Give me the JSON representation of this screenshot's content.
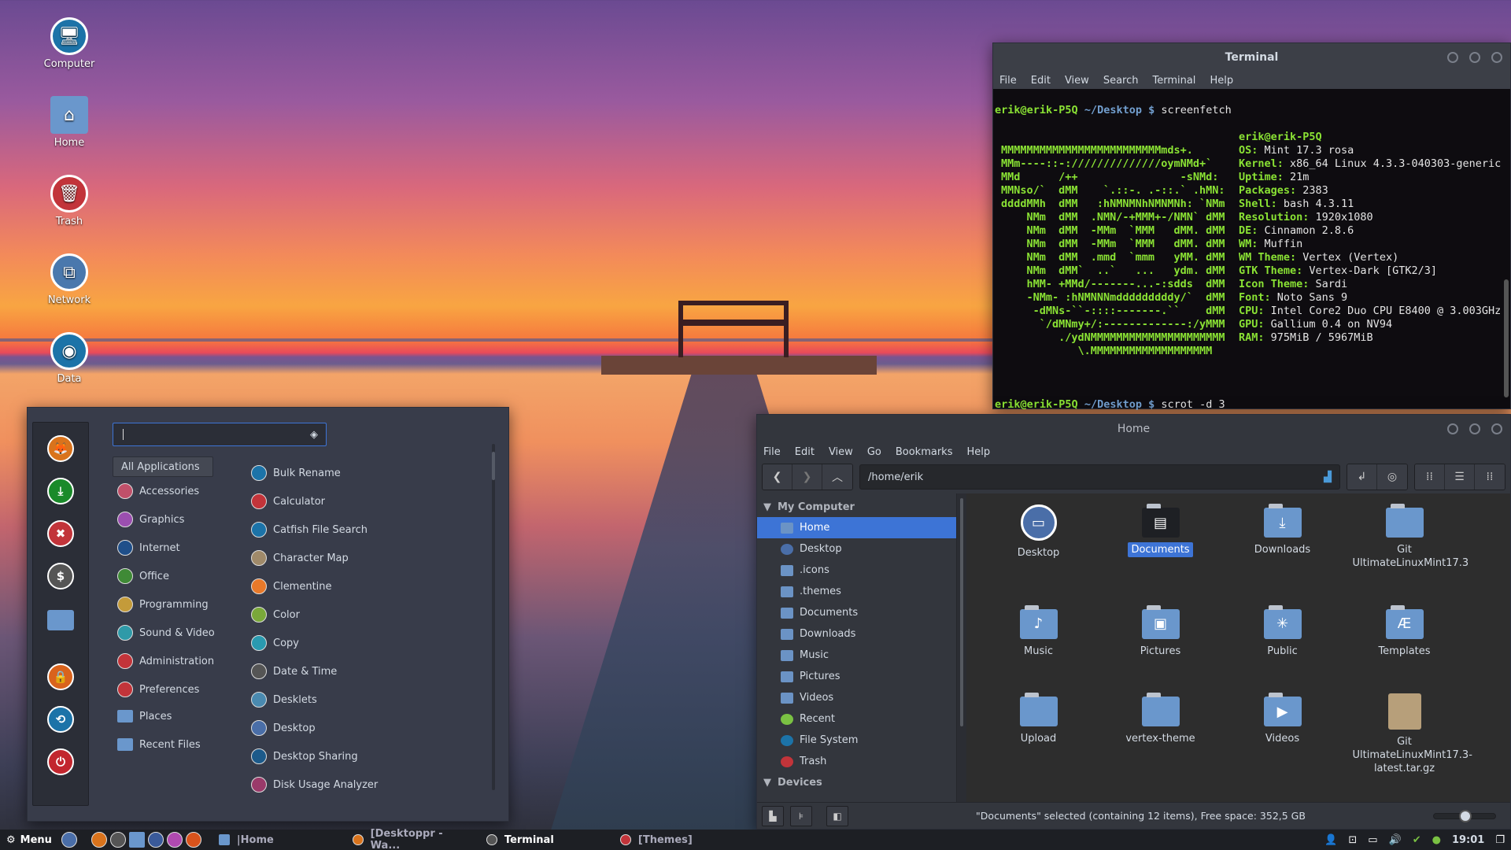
{
  "desktop": {
    "icons": [
      {
        "label": "Computer",
        "icon": "computer-icon",
        "color": "#1c73a8"
      },
      {
        "label": "Home",
        "icon": "home-folder-icon",
        "color": "#6a97cc"
      },
      {
        "label": "Trash",
        "icon": "trash-icon",
        "color": "#c2343a"
      },
      {
        "label": "Network",
        "icon": "network-icon",
        "color": "#4a78ad"
      },
      {
        "label": "Data",
        "icon": "drive-icon",
        "color": "#1c73a8"
      }
    ]
  },
  "terminal": {
    "title": "Terminal",
    "menu": [
      "File",
      "Edit",
      "View",
      "Search",
      "Terminal",
      "Help"
    ],
    "prompt_user": "erik@erik-P5Q",
    "prompt_path": "~/Desktop $",
    "command1": "screenfetch",
    "command2": "scrot -d 3",
    "ascii": [
      "MMMMMMMMMMMMMMMMMMMMMMMMMmds+.",
      "MMm----::-://////////////oymNMd+`",
      "MMd      /++                -sNMd:",
      "MMNso/`  dMM    `.::-. .-::.` .hMN:",
      "ddddMMh  dMM   :hNMNMNhNMNMNh: `NMm",
      "    NMm  dMM  .NMN/-+MMM+-/NMN` dMM",
      "    NMm  dMM  -MMm  `MMM   dMM. dMM",
      "    NMm  dMM  -MMm  `MMM   dMM. dMM",
      "    NMm  dMM  .mmd  `mmm   yMM. dMM",
      "    NMm  dMM`  ..`   ...   ydm. dMM",
      "    hMM- +MMd/-------...-:sdds  dMM",
      "    -NMm- :hNMNNNmdddddddddy/`  dMM",
      "     -dMNs-``-::::-------.``    dMM",
      "      `/dMNmy+/:-------------:/yMMM",
      "         ./ydNMMMMMMMMMMMMMMMMMMMMM",
      "            \\.MMMMMMMMMMMMMMMMMMM"
    ],
    "info_host": "erik@erik-P5Q",
    "info": [
      {
        "key": "OS:",
        "value": " Mint 17.3 rosa"
      },
      {
        "key": "Kernel:",
        "value": " x86_64 Linux 4.3.3-040303-generic"
      },
      {
        "key": "Uptime:",
        "value": " 21m"
      },
      {
        "key": "Packages:",
        "value": " 2383"
      },
      {
        "key": "Shell:",
        "value": " bash 4.3.11"
      },
      {
        "key": "Resolution:",
        "value": " 1920x1080"
      },
      {
        "key": "DE:",
        "value": " Cinnamon 2.8.6"
      },
      {
        "key": "WM:",
        "value": " Muffin"
      },
      {
        "key": "WM Theme:",
        "value": " Vertex (Vertex)"
      },
      {
        "key": "GTK Theme:",
        "value": " Vertex-Dark [GTK2/3]"
      },
      {
        "key": "Icon Theme:",
        "value": " Sardi"
      },
      {
        "key": "Font:",
        "value": " Noto Sans 9"
      },
      {
        "key": "CPU:",
        "value": " Intel Core2 Duo CPU E8400 @ 3.003GHz"
      },
      {
        "key": "GPU:",
        "value": " Gallium 0.4 on NV94"
      },
      {
        "key": "RAM:",
        "value": " 975MiB / 5967MiB"
      }
    ]
  },
  "filemanager": {
    "title": "Home",
    "menu": [
      "File",
      "Edit",
      "View",
      "Go",
      "Bookmarks",
      "Help"
    ],
    "location": "/home/erik",
    "sidebar": {
      "section1": "My Computer",
      "items": [
        {
          "label": "Home",
          "active": true,
          "icon": "home-icon"
        },
        {
          "label": "Desktop",
          "icon": "desktop-icon"
        },
        {
          "label": ".icons",
          "icon": "folder-icon"
        },
        {
          "label": ".themes",
          "icon": "folder-icon"
        },
        {
          "label": "Documents",
          "icon": "documents-folder-icon"
        },
        {
          "label": "Downloads",
          "icon": "downloads-folder-icon"
        },
        {
          "label": "Music",
          "icon": "music-folder-icon"
        },
        {
          "label": "Pictures",
          "icon": "pictures-folder-icon"
        },
        {
          "label": "Videos",
          "icon": "videos-folder-icon"
        },
        {
          "label": "Recent",
          "icon": "recent-icon"
        },
        {
          "label": "File System",
          "icon": "filesystem-icon"
        },
        {
          "label": "Trash",
          "icon": "trash-icon"
        }
      ],
      "section2": "Devices"
    },
    "files": [
      {
        "label": "Desktop",
        "icon": "desktop-icon",
        "glyph": "▭"
      },
      {
        "label": "Documents",
        "icon": "documents-folder-icon",
        "glyph": "▤",
        "selected": true
      },
      {
        "label": "Downloads",
        "icon": "downloads-folder-icon",
        "glyph": "⤓"
      },
      {
        "label": "Git UltimateLinuxMint17.3",
        "icon": "folder-icon",
        "glyph": ""
      },
      {
        "label": "Music",
        "icon": "music-folder-icon",
        "glyph": "♪"
      },
      {
        "label": "Pictures",
        "icon": "pictures-folder-icon",
        "glyph": "▣"
      },
      {
        "label": "Public",
        "icon": "public-folder-icon",
        "glyph": "✳"
      },
      {
        "label": "Templates",
        "icon": "templates-folder-icon",
        "glyph": "Æ"
      },
      {
        "label": "Upload",
        "icon": "folder-icon",
        "glyph": ""
      },
      {
        "label": "vertex-theme",
        "icon": "folder-icon",
        "glyph": ""
      },
      {
        "label": "Videos",
        "icon": "videos-folder-icon",
        "glyph": "▶"
      },
      {
        "label": "Git UltimateLinuxMint17.3-latest.tar.gz",
        "icon": "archive-icon",
        "glyph": ""
      }
    ],
    "status": "\"Documents\" selected (containing 12 items), Free space: 352,5 GB",
    "zoom_level": 0.5
  },
  "menu": {
    "search_value": "",
    "all_applications": "All Applications",
    "favorites": [
      {
        "icon": "firefox-icon",
        "color": "#d9731c",
        "glyph": "🦊"
      },
      {
        "icon": "software-manager-icon",
        "color": "#1a8a2a",
        "glyph": "⤓"
      },
      {
        "icon": "system-settings-icon",
        "color": "#c2343a",
        "glyph": "✖"
      },
      {
        "icon": "terminal-icon",
        "color": "#555",
        "glyph": "$"
      },
      {
        "icon": "files-icon",
        "color": "#6a97cc",
        "glyph": ""
      },
      {
        "icon": "lock-screen-icon",
        "color": "#d9631c",
        "glyph": "🔒"
      },
      {
        "icon": "logout-icon",
        "color": "#1c73a8",
        "glyph": "⟲"
      },
      {
        "icon": "shutdown-icon",
        "color": "#c2262e",
        "glyph": "⏻"
      }
    ],
    "categories": [
      {
        "label": "Accessories",
        "color": "#c0506a"
      },
      {
        "label": "Graphics",
        "color": "#9b4fb0"
      },
      {
        "label": "Internet",
        "color": "#1f4f8a"
      },
      {
        "label": "Office",
        "color": "#3f8a36"
      },
      {
        "label": "Programming",
        "color": "#c49b3a"
      },
      {
        "label": "Sound & Video",
        "color": "#2f9aa8"
      },
      {
        "label": "Administration",
        "color": "#c2343a"
      },
      {
        "label": "Preferences",
        "color": "#c2343a"
      },
      {
        "label": "Places",
        "color": "folder"
      },
      {
        "label": "Recent Files",
        "color": "folder"
      }
    ],
    "apps": [
      {
        "label": "Bulk Rename",
        "color": "#1c73a8"
      },
      {
        "label": "Calculator",
        "color": "#c2343a"
      },
      {
        "label": "Catfish File Search",
        "color": "#1c73a8"
      },
      {
        "label": "Character Map",
        "color": "#a08a6a"
      },
      {
        "label": "Clementine",
        "color": "#e8792a"
      },
      {
        "label": "Color",
        "color": "#7aa83a"
      },
      {
        "label": "Copy",
        "color": "#2a9ab0"
      },
      {
        "label": "Date & Time",
        "color": "#555"
      },
      {
        "label": "Desklets",
        "color": "#4a8ab0"
      },
      {
        "label": "Desktop",
        "color": "#4a6ea8"
      },
      {
        "label": "Desktop Sharing",
        "color": "#1c5a8a"
      },
      {
        "label": "Disk Usage Analyzer",
        "color": "#9a3a6a"
      }
    ]
  },
  "panel": {
    "menu_label": "Menu",
    "launchers": [
      {
        "icon": "show-desktop-icon",
        "color": "#4a6ea8"
      },
      {
        "icon": "firefox-icon",
        "color": "#d9731c"
      },
      {
        "icon": "terminal-icon",
        "color": "#555"
      },
      {
        "icon": "files-icon",
        "color": "#6a97cc"
      },
      {
        "icon": "screenshot-icon",
        "color": "#3a5a9a"
      },
      {
        "icon": "media-icon",
        "color": "#b04ab0"
      },
      {
        "icon": "chrome-icon",
        "color": "#d9531c"
      }
    ],
    "tasks": [
      {
        "label": "|Home",
        "icon": "folder-icon",
        "active": false
      },
      {
        "label": "[Desktoppr - Wa...",
        "icon": "firefox-icon",
        "active": false
      },
      {
        "label": "Terminal",
        "icon": "terminal-icon",
        "active": true
      },
      {
        "label": "[Themes]",
        "icon": "settings-icon",
        "active": false
      }
    ],
    "clock": "19:01"
  }
}
